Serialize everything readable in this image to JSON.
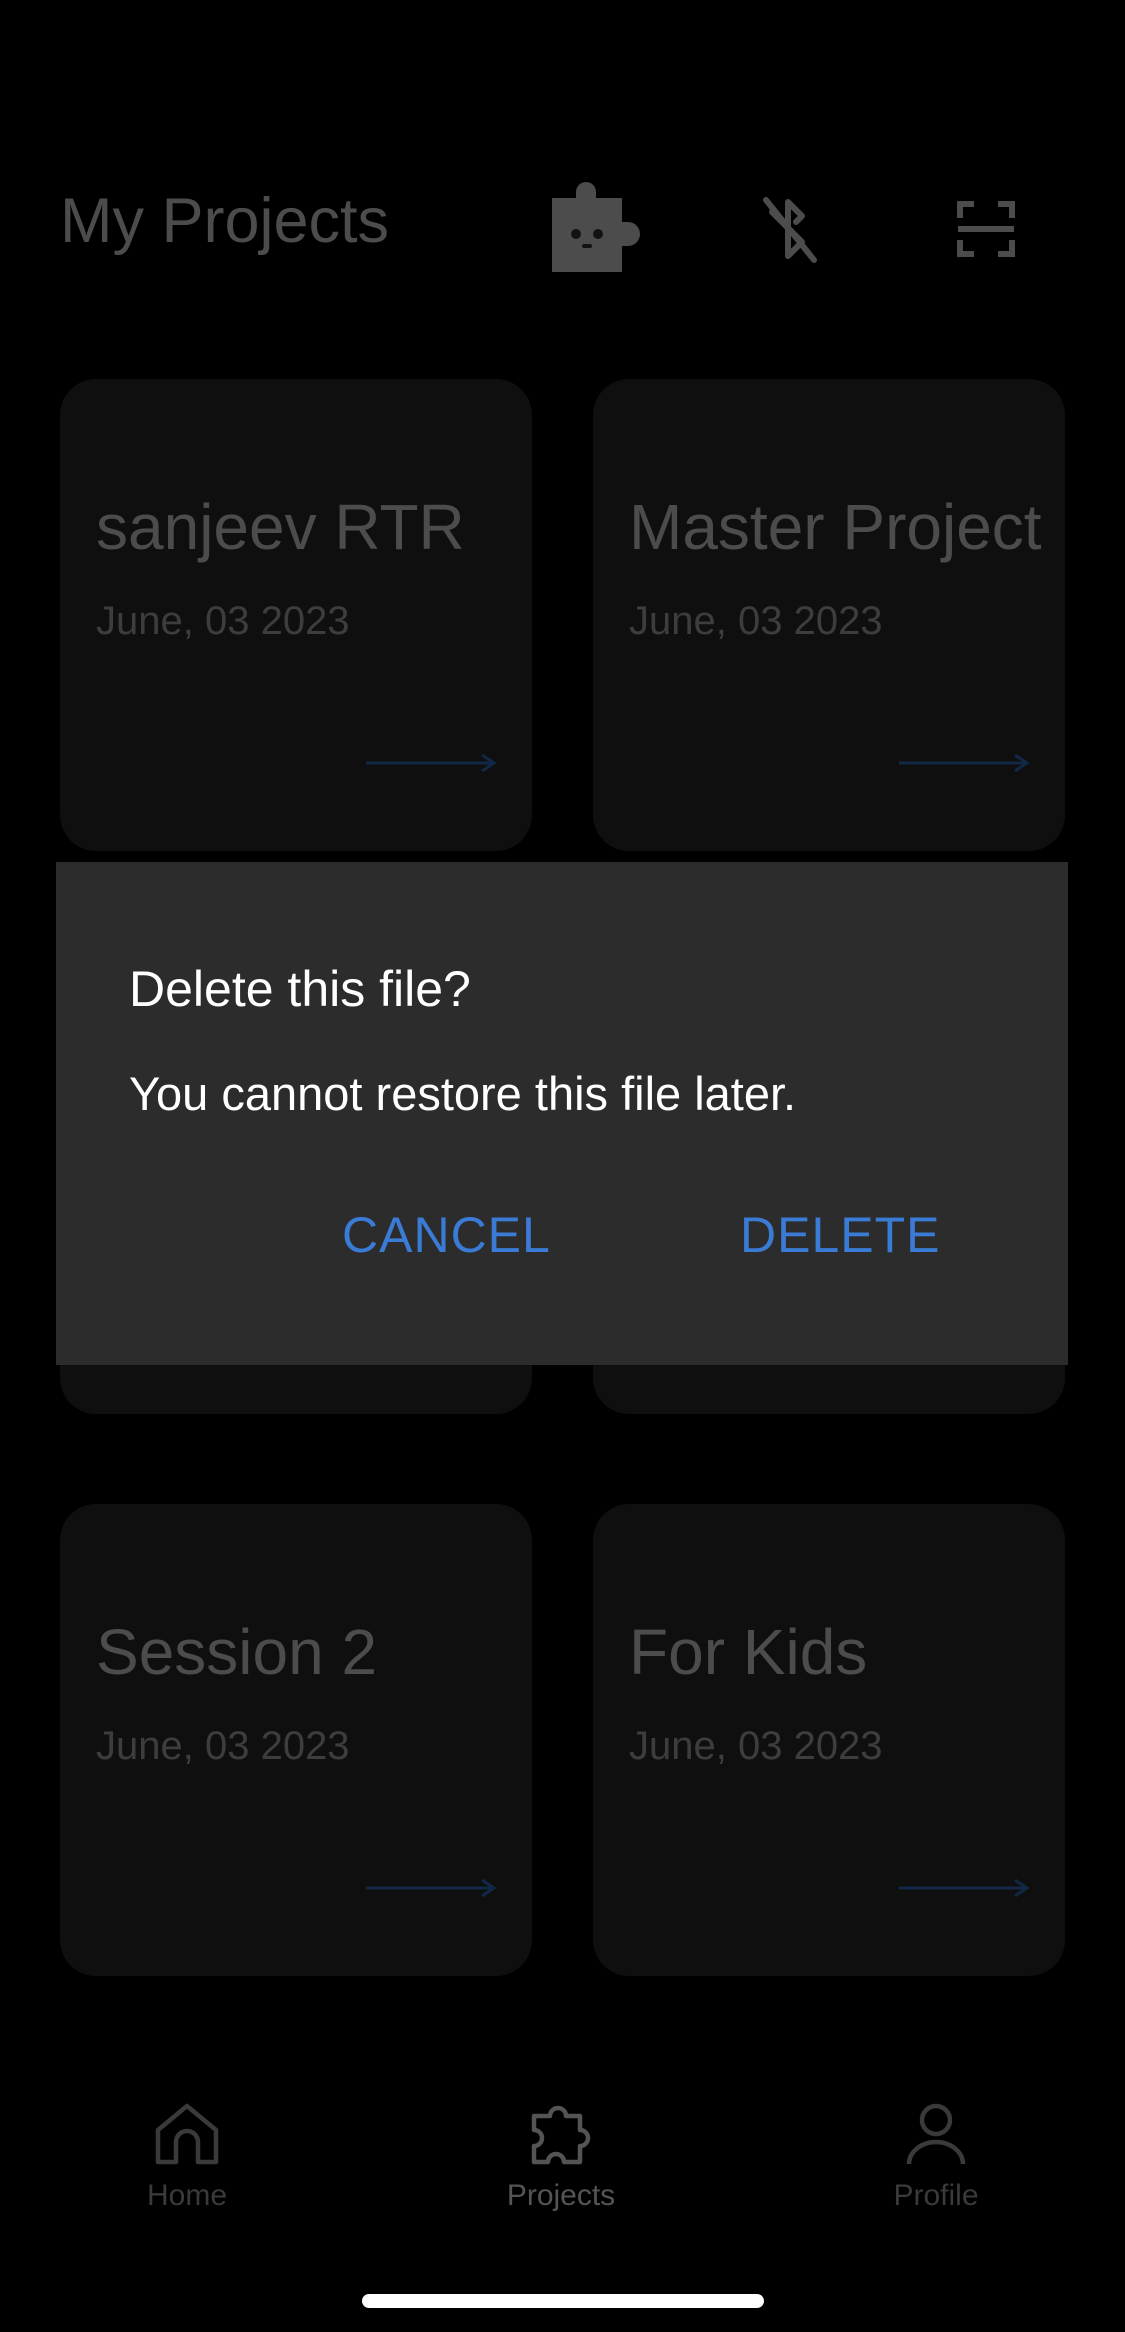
{
  "header": {
    "title": "My Projects",
    "icons": [
      "plugin-mascot-icon",
      "bluetooth-off-icon",
      "scan-frame-icon"
    ]
  },
  "projects": [
    {
      "title": "sanjeev RTR",
      "date": "June, 03 2023"
    },
    {
      "title": "Master Project",
      "date": "June, 03 2023"
    },
    {
      "title": "",
      "date": ""
    },
    {
      "title": "",
      "date": ""
    },
    {
      "title": "Session 2",
      "date": "June, 03 2023"
    },
    {
      "title": "For Kids",
      "date": "June, 03 2023"
    }
  ],
  "dialog": {
    "title": "Delete this file?",
    "message": "You cannot restore this file later.",
    "cancel_label": "CANCEL",
    "delete_label": "DELETE"
  },
  "tabbar": {
    "items": [
      {
        "label": "Home",
        "icon": "home-icon"
      },
      {
        "label": "Projects",
        "icon": "puzzle-icon",
        "active": true
      },
      {
        "label": "Profile",
        "icon": "profile-icon"
      }
    ]
  },
  "colors": {
    "background": "#000000",
    "card": "#1c1c1c",
    "dialog": "#2c2c2c",
    "accent": "#3a7bd5"
  }
}
